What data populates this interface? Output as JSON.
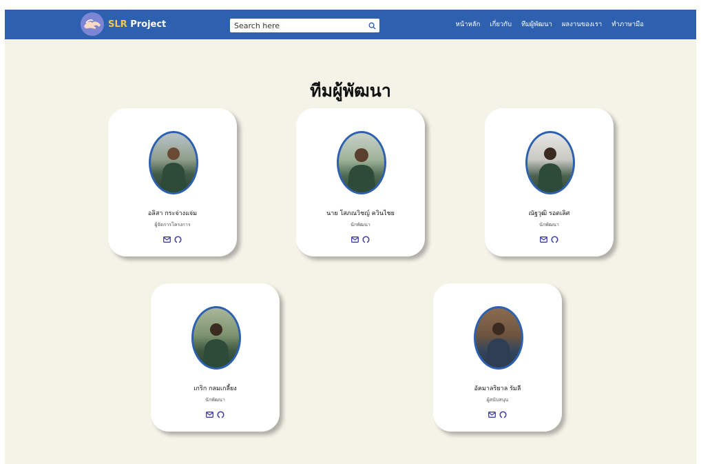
{
  "navbar": {
    "brand_accent": "SLR",
    "brand_rest": " Project",
    "search_placeholder": "Search here",
    "links": [
      "หน้าหลัก",
      "เกี่ยวกับ",
      "ทีมผู้พัฒนา",
      "ผลงานของเรา",
      "ทำภาษามือ"
    ]
  },
  "page_title": "ทีมผู้พัฒนา",
  "members": [
    {
      "name": "อลิสา กระจ่างแจ่ม",
      "role": "ผู้จัดการโครงการ",
      "email_icon": "email-icon",
      "github_icon": "github-icon"
    },
    {
      "name": "นาย โสภณวิชญ์ ควินไชย",
      "role": "นักพัฒนา",
      "email_icon": "email-icon",
      "github_icon": "github-icon"
    },
    {
      "name": "ณัฐวุฒิ รอดเลิศ",
      "role": "นักพัฒนา",
      "email_icon": "email-icon",
      "github_icon": "github-icon"
    },
    {
      "name": "เกริก กลมเกลี้ยง",
      "role": "นักพัฒนา",
      "email_icon": "email-icon",
      "github_icon": "github-icon"
    },
    {
      "name": "อัคมาลริยาล รัมลี",
      "role": "ผู้สนับสนุน",
      "email_icon": "email-icon",
      "github_icon": "github-icon"
    }
  ],
  "colors": {
    "navbar": "#2e60b0",
    "background": "#f4f3e8",
    "brand_accent": "#f2c94c",
    "photo_border": "#2e60b0",
    "icon": "#3a3aa8"
  }
}
